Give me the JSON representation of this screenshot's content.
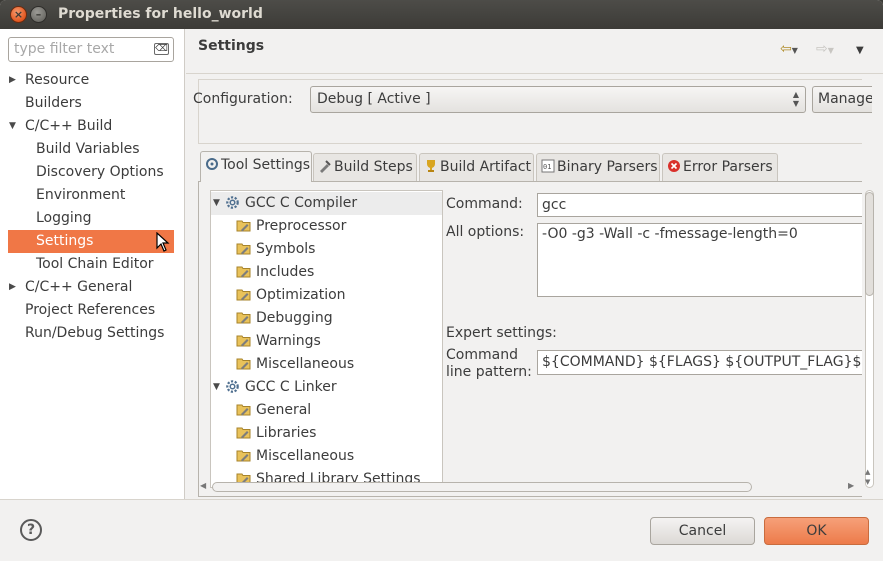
{
  "window": {
    "title": "Properties for hello_world"
  },
  "left": {
    "filter_placeholder": "type filter text",
    "items": [
      {
        "label": "Resource",
        "level": 0,
        "expandable": true
      },
      {
        "label": "Builders",
        "level": 0,
        "expandable": false
      },
      {
        "label": "C/C++ Build",
        "level": 0,
        "expandable": true,
        "expanded": true
      },
      {
        "label": "Build Variables",
        "level": 1
      },
      {
        "label": "Discovery Options",
        "level": 1
      },
      {
        "label": "Environment",
        "level": 1
      },
      {
        "label": "Logging",
        "level": 1
      },
      {
        "label": "Settings",
        "level": 1,
        "selected": true
      },
      {
        "label": "Tool Chain Editor",
        "level": 1
      },
      {
        "label": "C/C++ General",
        "level": 0,
        "expandable": true
      },
      {
        "label": "Project References",
        "level": 0
      },
      {
        "label": "Run/Debug Settings",
        "level": 0
      }
    ]
  },
  "main": {
    "heading": "Settings",
    "config_label": "Configuration:",
    "config_value": "Debug  [ Active ]",
    "manage_label": "Manage Configurations...",
    "tabs": [
      {
        "label": "Tool Settings",
        "icon": "tool-settings-icon",
        "active": true
      },
      {
        "label": "Build Steps",
        "icon": "build-steps-icon"
      },
      {
        "label": "Build Artifact",
        "icon": "trophy-icon"
      },
      {
        "label": "Binary Parsers",
        "icon": "binary-icon"
      },
      {
        "label": "Error Parsers",
        "icon": "error-icon"
      }
    ],
    "tool_tree": [
      {
        "label": "GCC C Compiler",
        "type": "tool",
        "expanded": true,
        "selected": true
      },
      {
        "label": "Preprocessor",
        "type": "option"
      },
      {
        "label": "Symbols",
        "type": "option"
      },
      {
        "label": "Includes",
        "type": "option"
      },
      {
        "label": "Optimization",
        "type": "option"
      },
      {
        "label": "Debugging",
        "type": "option"
      },
      {
        "label": "Warnings",
        "type": "option"
      },
      {
        "label": "Miscellaneous",
        "type": "option"
      },
      {
        "label": "GCC C Linker",
        "type": "tool",
        "expanded": true
      },
      {
        "label": "General",
        "type": "option"
      },
      {
        "label": "Libraries",
        "type": "option"
      },
      {
        "label": "Miscellaneous",
        "type": "option"
      },
      {
        "label": "Shared Library Settings",
        "type": "option"
      }
    ],
    "command_label": "Command:",
    "command_value": "gcc",
    "all_options_label": "All options:",
    "all_options_value": "-O0 -g3 -Wall -c -fmessage-length=0",
    "expert_label": "Expert settings:",
    "pattern_label_1": "Command",
    "pattern_label_2": "line pattern:",
    "pattern_value": "${COMMAND} ${FLAGS} ${OUTPUT_FLAG}${OUTPUT_PREFIX}${OUTPUT} ${INPUTS}"
  },
  "buttons": {
    "help": "?",
    "cancel": "Cancel",
    "ok": "OK"
  },
  "colors": {
    "selection": "#f07746",
    "titlebar": "#3c3b37",
    "ok_button": "#ed7b4a"
  }
}
